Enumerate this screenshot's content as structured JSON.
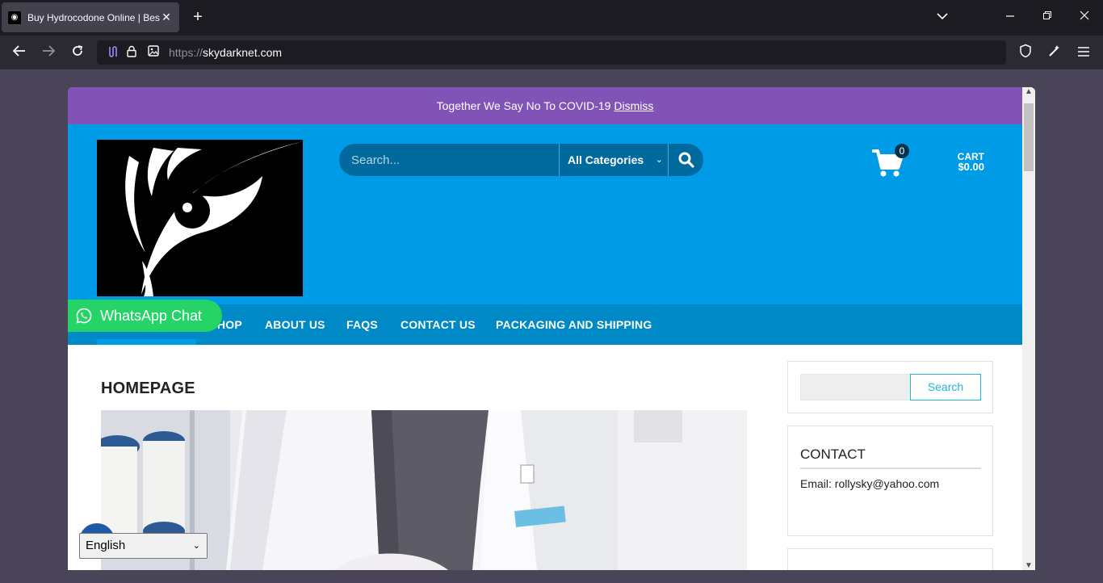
{
  "browser": {
    "tab_title": "Buy Hydrocodone Online | Best",
    "tab_close": "✕",
    "new_tab": "+",
    "url_scheme": "https://",
    "url_host": "skydarknet.com"
  },
  "site": {
    "notice_text": "Together We Say No To COVID-19 ",
    "notice_dismiss": "Dismiss",
    "search_placeholder": "Search...",
    "category_label": "All Categories",
    "cart": {
      "count": "0",
      "label": "CART",
      "total": "$0.00"
    },
    "menu": [
      {
        "label": "HOP"
      },
      {
        "label": "ABOUT US"
      },
      {
        "label": "FAQS"
      },
      {
        "label": "CONTACT US"
      },
      {
        "label": "PACKAGING AND SHIPPING"
      }
    ],
    "whatsapp_label": "WhatsApp Chat",
    "page_title": "HOMEPAGE",
    "sidebar": {
      "search_button": "Search",
      "contact_title": "CONTACT",
      "contact_email": "Email: rollysky@yahoo.com"
    },
    "language_selected": "English"
  },
  "colors": {
    "notice_bg": "#8153b7",
    "header_bg": "#009be6",
    "menu_bg": "#0089c7",
    "whatsapp": "#25d366",
    "accent": "#1fb6d6"
  }
}
